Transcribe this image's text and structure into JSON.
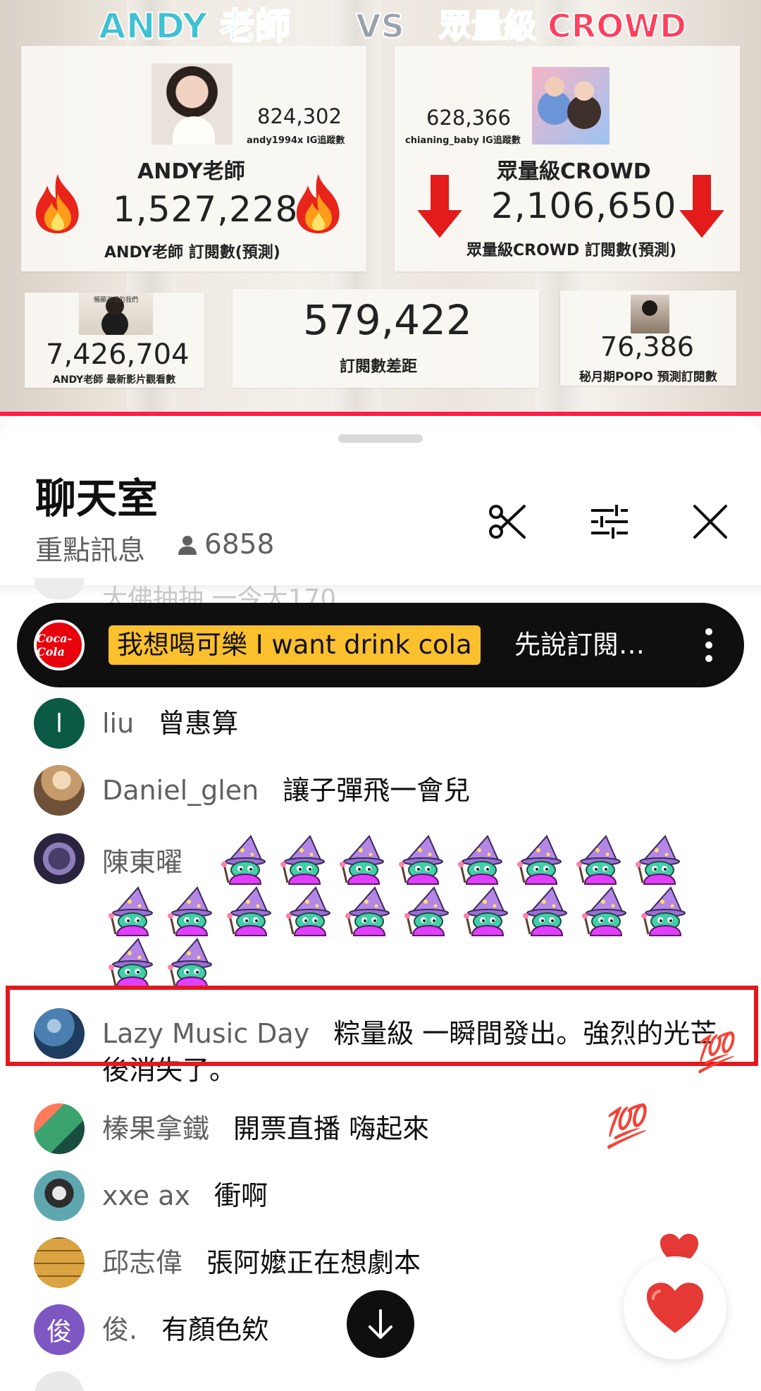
{
  "video": {
    "headline_left": "ANDY 老師",
    "headline_vs": "VS",
    "headline_right": "眾量級 CROWD",
    "andy": {
      "ig_count": "824,302",
      "ig_label": "andy1994x IG追蹤數",
      "name": "ANDY老師",
      "subs": "1,527,228",
      "subs_label": "ANDY老師 訂閱數(預測)"
    },
    "crowd": {
      "ig_count": "628,366",
      "ig_label": "chianing_baby IG追蹤數",
      "name": "眾量級CROWD",
      "subs": "2,106,650",
      "subs_label": "眾量級CROWD 訂閱數(預測)"
    },
    "bottom_left": {
      "value": "7,426,704",
      "label": "ANDY老師 最新影片觀看數",
      "thumb_caption": "暢顯不暢的我們"
    },
    "bottom_mid": {
      "value": "579,422",
      "label": "訂閱數差距"
    },
    "bottom_right": {
      "value": "76,386",
      "label": "秘月期POPO 預測訂閱數"
    },
    "progress_color": "#ff1c4a"
  },
  "chat": {
    "title": "聊天室",
    "mode": "重點訊息",
    "viewer_count": "6858",
    "ghost_text": "大佛抽抽 一今大170",
    "pinned": {
      "logo_text": "Coca-Cola",
      "tag": "我想喝可樂 I want drink cola",
      "text": "先說訂閱…"
    },
    "messages": [
      {
        "author": "liu",
        "text": "曾惠算",
        "avatar": {
          "kind": "letter",
          "letter": "l",
          "color": "#0b5a45"
        }
      },
      {
        "author": "Daniel_glen",
        "text": "讓子彈飛一會兒",
        "avatar": {
          "kind": "photo",
          "color": "#8c6f52"
        }
      },
      {
        "author": "陳東曜",
        "text": "",
        "avatar": {
          "kind": "pattern",
          "color": "#4a3c6a"
        }
      },
      {
        "author": "Lazy Music Day",
        "text": "粽量級 一瞬間發出。強烈的光芒 後消失了。",
        "avatar": {
          "kind": "photo",
          "color": "#2f5a86"
        }
      },
      {
        "author": "榛果拿鐵",
        "text": "開票直播 嗨起來",
        "avatar": {
          "kind": "photo",
          "color": "#3aa36f"
        }
      },
      {
        "author": "xxe ax",
        "text": "衝啊",
        "avatar": {
          "kind": "photo",
          "color": "#3b7f87"
        }
      },
      {
        "author": "邱志偉",
        "text": "張阿嬤正在想劇本",
        "avatar": {
          "kind": "photo",
          "color": "#b58a3c"
        }
      },
      {
        "author": "俊.",
        "text": "有顏色欸",
        "avatar": {
          "kind": "letter",
          "letter": "俊",
          "color": "#7e57c2"
        }
      }
    ],
    "float_emoji": [
      "💯",
      "💯",
      "❤️",
      "❤️"
    ],
    "emote_count": 20
  }
}
